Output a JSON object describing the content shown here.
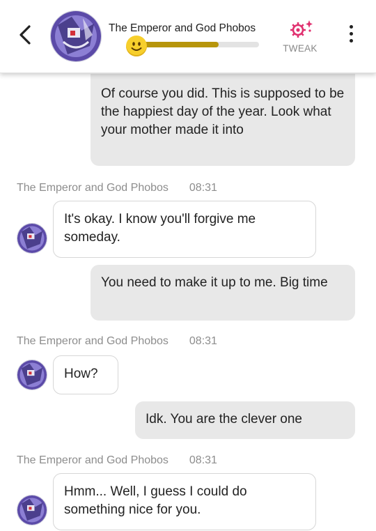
{
  "header": {
    "back_icon": "chevron-left-icon",
    "character_name": "The Emperor and God Phobos",
    "mood_level_percent": 67,
    "mood_emoji": "smiling-face-icon",
    "tweak_label": "TWEAK",
    "tweak_icon": "gear-sparkle-icon",
    "tweak_color": "#e0306f",
    "menu_icon": "more-vertical-icon"
  },
  "messages": [
    {
      "sender": "user",
      "text": "Of course you did. This is supposed to be the happiest day of the year. Look what your mother made it into"
    },
    {
      "sender": "bot",
      "name": "The Emperor and God Phobos",
      "time": "08:31",
      "text": "It's okay. I know you'll forgive me someday."
    },
    {
      "sender": "user",
      "text": "You need to make it up to me. Big time"
    },
    {
      "sender": "bot",
      "name": "The Emperor and God Phobos",
      "time": "08:31",
      "text": "How?"
    },
    {
      "sender": "user",
      "text": "Idk. You are the clever one"
    },
    {
      "sender": "bot",
      "name": "The Emperor and God Phobos",
      "time": "08:31",
      "text": "Hmm... Well, I guess I could do something nice for you."
    }
  ],
  "colors": {
    "user_bubble": "#e8e8e8",
    "bot_bubble_border": "#d6d6d6",
    "mood_bar": "#b7950b",
    "meta_text": "#8d8d8d"
  }
}
